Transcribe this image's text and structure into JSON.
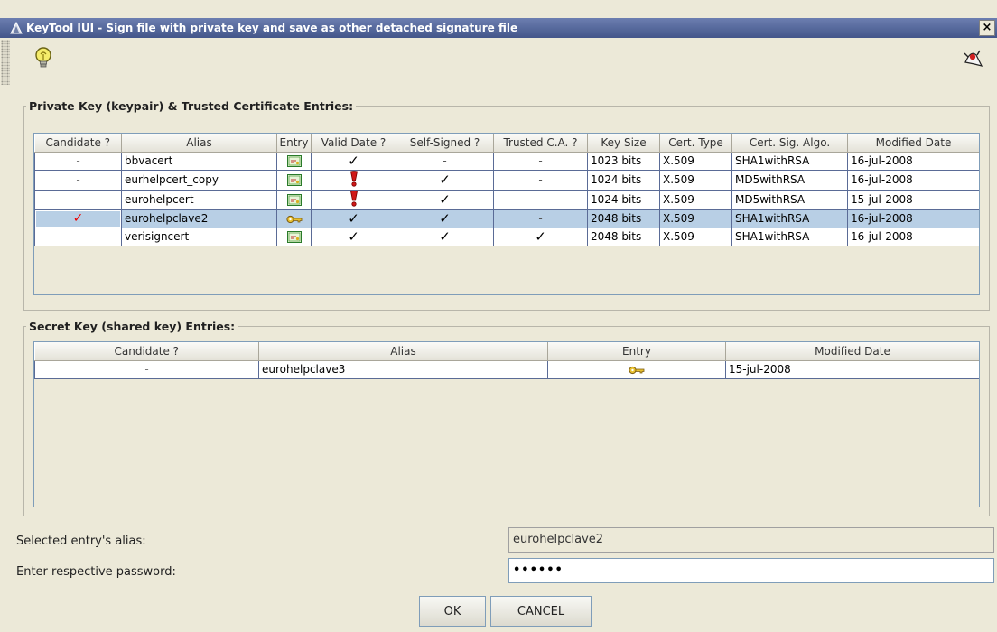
{
  "window": {
    "title": "KeyTool IUI - Sign file with private key and save as other detached signature file",
    "close_label": "×"
  },
  "toolbar": {
    "tip_icon": "lightbulb-icon",
    "app_icon": "java-duke-icon"
  },
  "private": {
    "legend": "Private Key (keypair) & Trusted Certificate Entries:",
    "headers": [
      "Candidate ?",
      "Alias",
      "Entry",
      "Valid Date ?",
      "Self-Signed ?",
      "Trusted C.A. ?",
      "Key Size",
      "Cert. Type",
      "Cert. Sig. Algo.",
      "Modified Date"
    ],
    "rows": [
      {
        "candidate": "-",
        "alias": "bbvacert",
        "entry": "certificate-icon",
        "valid": "✓",
        "self_signed": "-",
        "trusted": "-",
        "key_size": "1023 bits",
        "cert_type": "X.509",
        "algo": "SHA1withRSA",
        "modified": "16-jul-2008"
      },
      {
        "candidate": "-",
        "alias": "eurhelpcert_copy",
        "entry": "certificate-icon",
        "valid": "!",
        "self_signed": "✓",
        "trusted": "-",
        "key_size": "1024 bits",
        "cert_type": "X.509",
        "algo": "MD5withRSA",
        "modified": "16-jul-2008"
      },
      {
        "candidate": "-",
        "alias": "eurohelpcert",
        "entry": "certificate-icon",
        "valid": "!",
        "self_signed": "✓",
        "trusted": "-",
        "key_size": "1024 bits",
        "cert_type": "X.509",
        "algo": "MD5withRSA",
        "modified": "15-jul-2008"
      },
      {
        "candidate": "✓",
        "alias": "eurohelpclave2",
        "entry": "key-icon",
        "valid": "✓",
        "self_signed": "✓",
        "trusted": "-",
        "key_size": "2048 bits",
        "cert_type": "X.509",
        "algo": "SHA1withRSA",
        "modified": "16-jul-2008",
        "selected": true
      },
      {
        "candidate": "-",
        "alias": "verisigncert",
        "entry": "certificate-icon",
        "valid": "✓",
        "self_signed": "✓",
        "trusted": "✓",
        "key_size": "2048 bits",
        "cert_type": "X.509",
        "algo": "SHA1withRSA",
        "modified": "16-jul-2008"
      }
    ]
  },
  "secret": {
    "legend": "Secret Key (shared key) Entries:",
    "headers": [
      "Candidate ?",
      "Alias",
      "Entry",
      "Modified Date"
    ],
    "rows": [
      {
        "candidate": "-",
        "alias": "eurohelpclave3",
        "entry": "key-icon",
        "modified": "15-jul-2008"
      }
    ]
  },
  "form": {
    "alias_label": "Selected entry's alias:",
    "alias_value": "eurohelpclave2",
    "password_label": "Enter respective password:",
    "password_value": "••••••"
  },
  "buttons": {
    "ok": "OK",
    "cancel": "CANCEL"
  }
}
